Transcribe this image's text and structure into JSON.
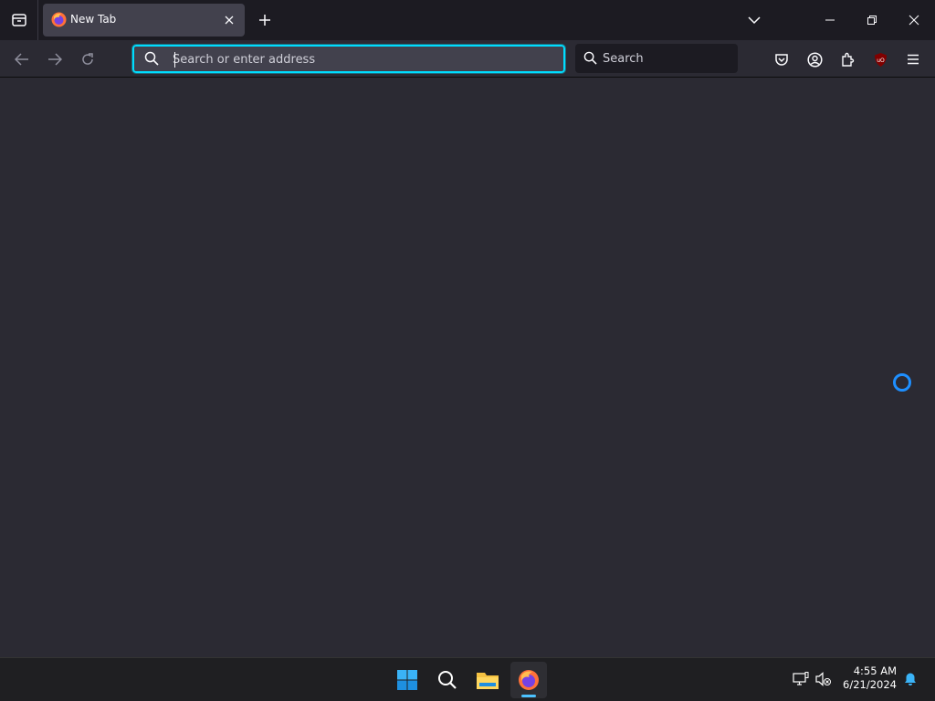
{
  "browser": {
    "tab": {
      "title": "New Tab"
    },
    "urlbar": {
      "placeholder": "Search or enter address",
      "value": ""
    },
    "searchbar": {
      "label": "Search"
    },
    "accent_color": "#00ddff",
    "toolbar_icons": [
      "pocket-icon",
      "account-icon",
      "extensions-icon",
      "ublock-origin-icon",
      "menu-icon"
    ]
  },
  "content": {
    "loading_indicator": "spinner"
  },
  "taskbar": {
    "apps": [
      "windows-start-icon",
      "search-icon",
      "file-explorer-icon",
      "firefox-icon"
    ],
    "active_app": "firefox",
    "clock": {
      "time": "4:55 AM",
      "date": "6/21/2024"
    }
  }
}
